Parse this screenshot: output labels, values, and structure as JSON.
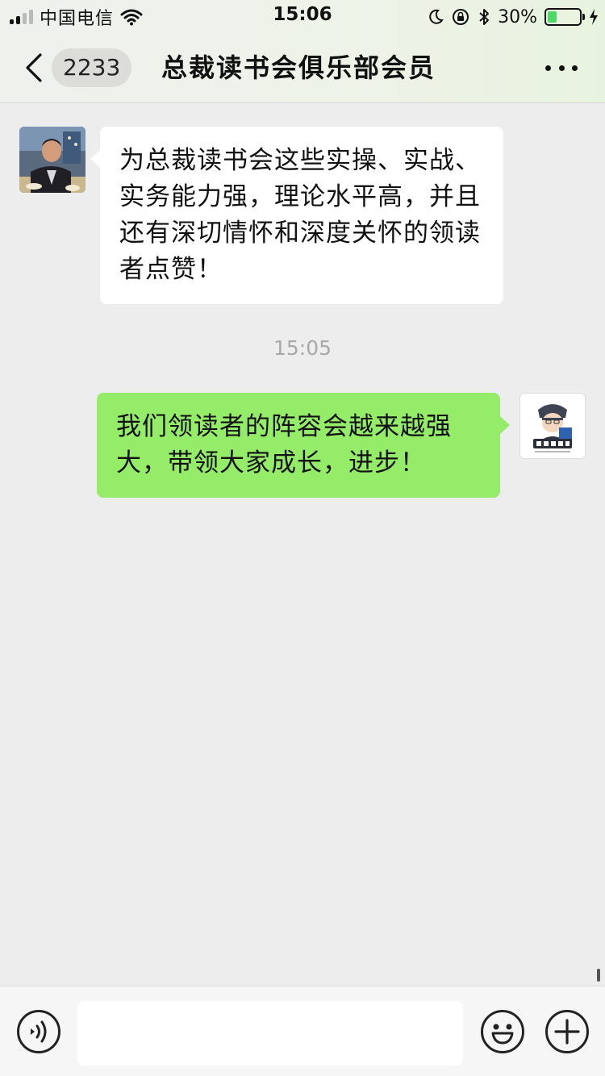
{
  "status_bar": {
    "carrier": "中国电信",
    "time": "15:06",
    "battery_percent": "30%",
    "battery_level": 0.3,
    "icons": [
      "signal-icon",
      "wifi-icon",
      "moon-icon",
      "orientation-lock-icon",
      "bluetooth-icon",
      "battery-icon",
      "charging-icon"
    ]
  },
  "header": {
    "back_icon": "chevron-left-icon",
    "unread_count": "2233",
    "title": "总裁读书会俱乐部会员",
    "more_icon": "more-icon"
  },
  "messages": [
    {
      "side": "left",
      "avatar": "member-avatar",
      "text": "为总裁读书会这些实操、实战、实务能力强，理论水平高，并且还有深切情怀和深度关怀的领读者点赞！"
    },
    {
      "side": "right",
      "avatar": "club-logo-avatar",
      "text": "我们领读者的阵容会越来越强大，带领大家成长，进步！"
    }
  ],
  "timestamp": "15:05",
  "input_bar": {
    "voice_icon": "voice-icon",
    "message_value": "",
    "emoji_icon": "emoji-icon",
    "plus_icon": "plus-icon"
  },
  "colors": {
    "chat_background": "#ededed",
    "incoming_bubble": "#ffffff",
    "outgoing_bubble": "#95ec69",
    "timestamp_text": "#a8a8a8"
  }
}
